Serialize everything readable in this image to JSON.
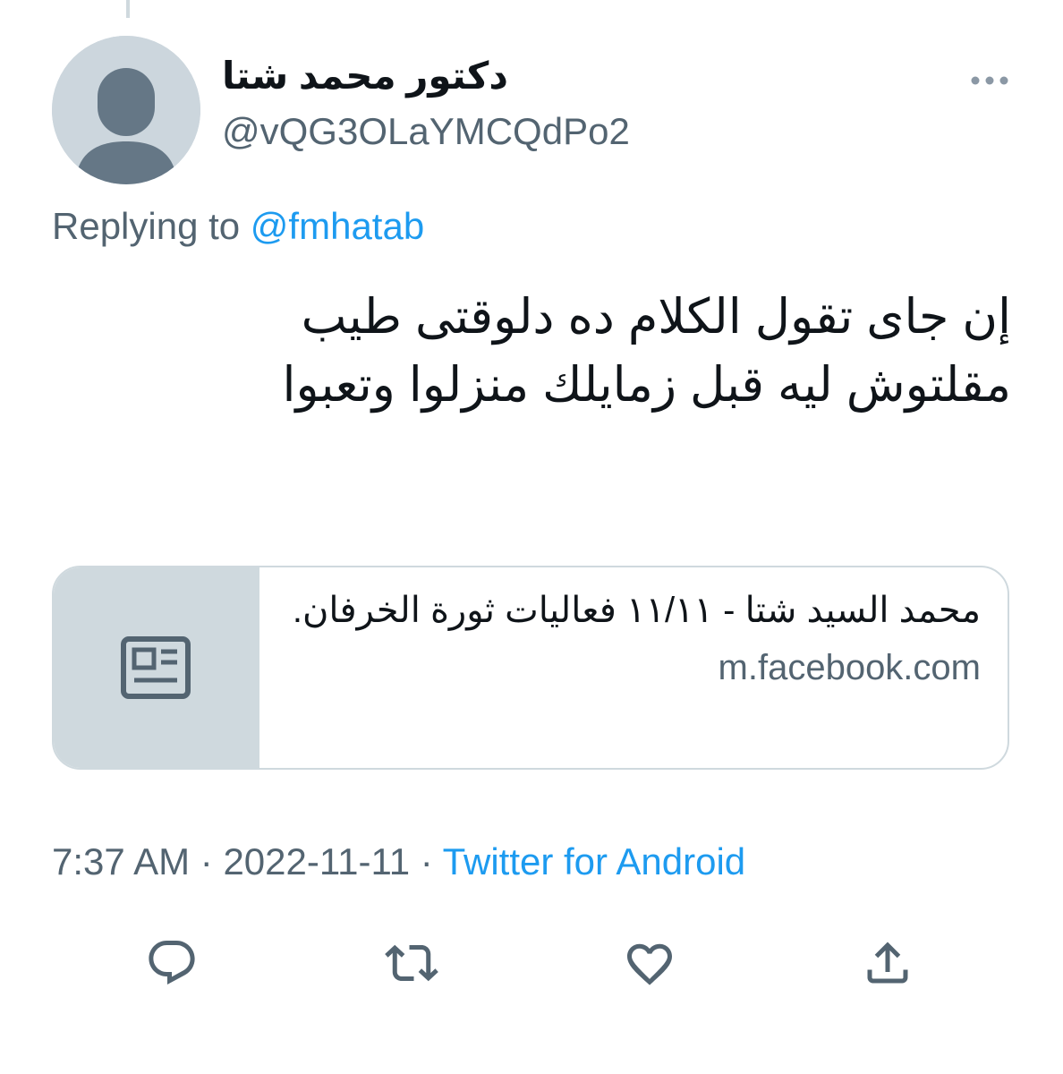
{
  "author": {
    "display_name": "دكتور محمد شتا",
    "handle": "@vQG3OLaYMCQdPo2"
  },
  "reply": {
    "prefix": "Replying to",
    "mention": "@fmhatab"
  },
  "tweet": {
    "line1": "إن جاى تقول الكلام ده دلوقتى طيب",
    "line2": "مقلتوش ليه قبل زمايلك منزلوا وتعبوا"
  },
  "link_card": {
    "title": "محمد السيد شتا - ١١/١١ فعاليات ثورة الخرفان.",
    "domain": "m.facebook.com",
    "thumb_icon": "news-article-icon"
  },
  "meta": {
    "time": "7:37 AM",
    "separator": "·",
    "date": "2022-11-11",
    "source": "Twitter for Android"
  },
  "actions": [
    "reply-icon",
    "retweet-icon",
    "like-icon",
    "share-icon"
  ],
  "colors": {
    "accent": "#1d9bf0",
    "secondary_text": "#536471",
    "border": "#cfd9de",
    "avatar_bg": "#ccd6dd",
    "avatar_fg": "#657786"
  }
}
